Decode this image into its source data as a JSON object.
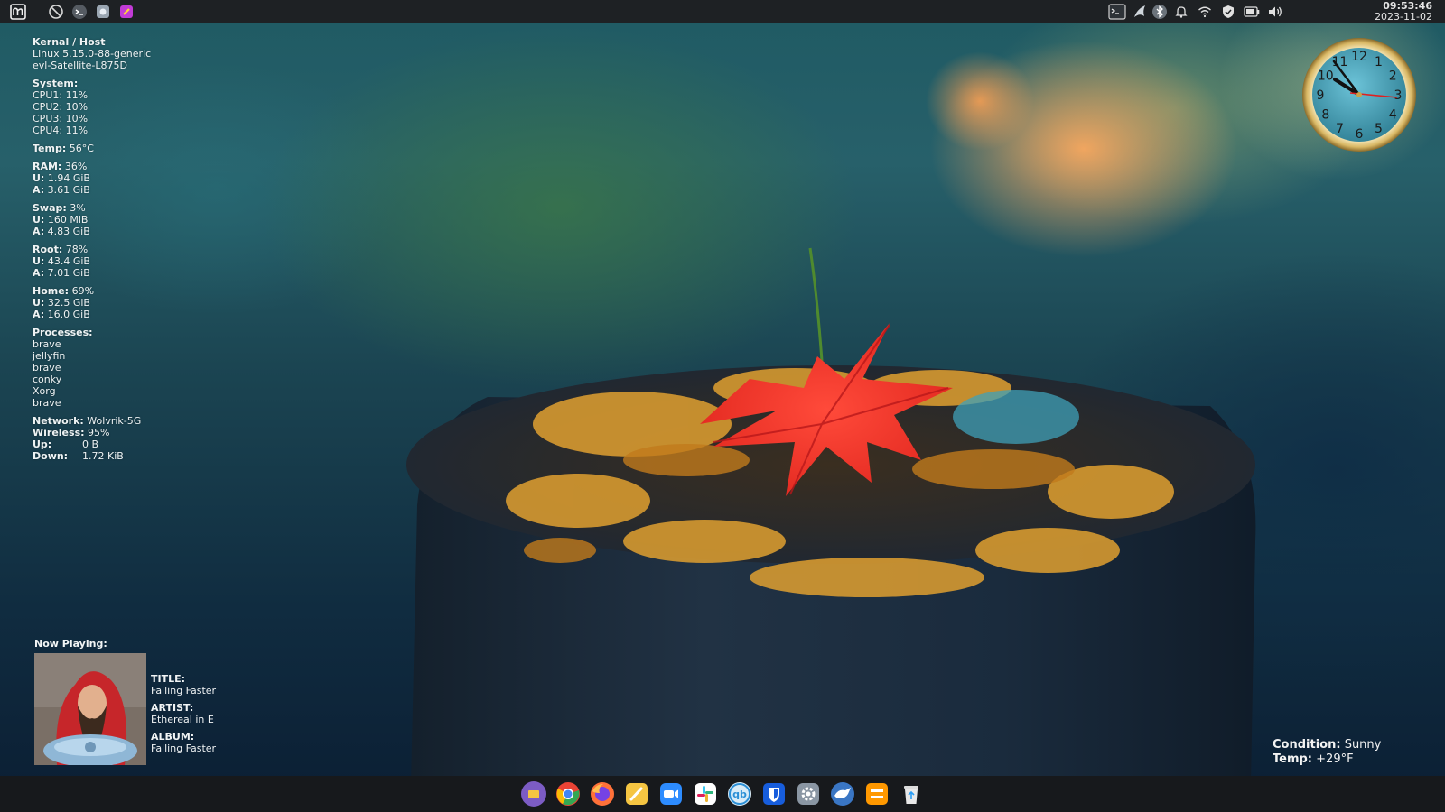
{
  "top_panel": {
    "launchers": [
      {
        "name": "app-menu-icon"
      },
      {
        "name": "do-not-disturb-icon"
      },
      {
        "name": "terminal-launcher-icon"
      },
      {
        "name": "screenshot-tool-icon"
      },
      {
        "name": "color-picker-icon"
      }
    ],
    "tray": [
      {
        "name": "terminal-tray-icon"
      },
      {
        "name": "flameshot-tray-icon"
      },
      {
        "name": "bluetooth-icon"
      },
      {
        "name": "notifications-bell-icon"
      },
      {
        "name": "wifi-icon"
      },
      {
        "name": "vpn-shield-icon"
      },
      {
        "name": "battery-icon"
      },
      {
        "name": "volume-icon"
      }
    ],
    "time": "09:53:46",
    "date": "2023-11-02"
  },
  "conky": {
    "kernel_heading": "Kernal / Host",
    "kernel": "Linux 5.15.0-88-generic",
    "host": "evl-Satellite-L875D",
    "system_heading": "System:",
    "cpus": [
      "CPU1: 11%",
      "CPU2: 10%",
      "CPU3: 10%",
      "CPU4: 11%"
    ],
    "temp_label": "Temp:",
    "temp_value": "56°C",
    "ram_label": "RAM:",
    "ram_value": "36%",
    "ram_used": "1.94 GiB",
    "ram_avail": "3.61 GiB",
    "swap_label": "Swap:",
    "swap_value": "3%",
    "swap_used": "160 MiB",
    "swap_avail": "4.83 GiB",
    "root_label": "Root:",
    "root_value": "78%",
    "root_used": "43.4 GiB",
    "root_avail": "7.01 GiB",
    "home_label": "Home:",
    "home_value": "69%",
    "home_used": "32.5 GiB",
    "home_avail": "16.0 GiB",
    "used_prefix": "U:",
    "avail_prefix": "A:",
    "processes_heading": "Processes:",
    "processes": [
      "brave",
      "jellyfin",
      "brave",
      "conky",
      "Xorg",
      "brave"
    ],
    "network_label": "Network:",
    "network_value": "Wolvrik-5G",
    "wireless_label": "Wireless:",
    "wireless_value": "95%",
    "up_label": "Up:",
    "up_value": "0 B",
    "down_label": "Down:",
    "down_value": "1.72 KiB"
  },
  "now_playing": {
    "heading": "Now Playing:",
    "title_label": "TITLE:",
    "title": "Falling Faster",
    "artist_label": "ARTIST:",
    "artist": "Ethereal in E",
    "album_label": "ALBUM:",
    "album": "Falling Faster"
  },
  "clock_face": {
    "numerals": [
      "12",
      "1",
      "2",
      "3",
      "4",
      "5",
      "6",
      "7",
      "8",
      "9",
      "10",
      "11"
    ]
  },
  "weather": {
    "condition_label": "Condition:",
    "condition": "Sunny",
    "temp_label": "Temp:",
    "temp": "+29°F"
  },
  "dock": {
    "apps": [
      {
        "name": "files-app-icon",
        "color": "#7c5cc4"
      },
      {
        "name": "chrome-app-icon",
        "color": "#ea4335"
      },
      {
        "name": "firefox-app-icon",
        "color": "#ff7139"
      },
      {
        "name": "notes-app-icon",
        "color": "#f5c542"
      },
      {
        "name": "zoom-app-icon",
        "color": "#2d8cff"
      },
      {
        "name": "slack-app-icon",
        "color": "#ffffff"
      },
      {
        "name": "qbittorrent-app-icon",
        "color": "#2b8fd6"
      },
      {
        "name": "bitwarden-app-icon",
        "color": "#175ddc"
      },
      {
        "name": "settings-app-icon",
        "color": "#8a96a3"
      },
      {
        "name": "remmina-app-icon",
        "color": "#3a76c4"
      },
      {
        "name": "sublime-app-icon",
        "color": "#ff9800"
      },
      {
        "name": "trash-app-icon",
        "color": "#dcdcdc"
      }
    ]
  }
}
